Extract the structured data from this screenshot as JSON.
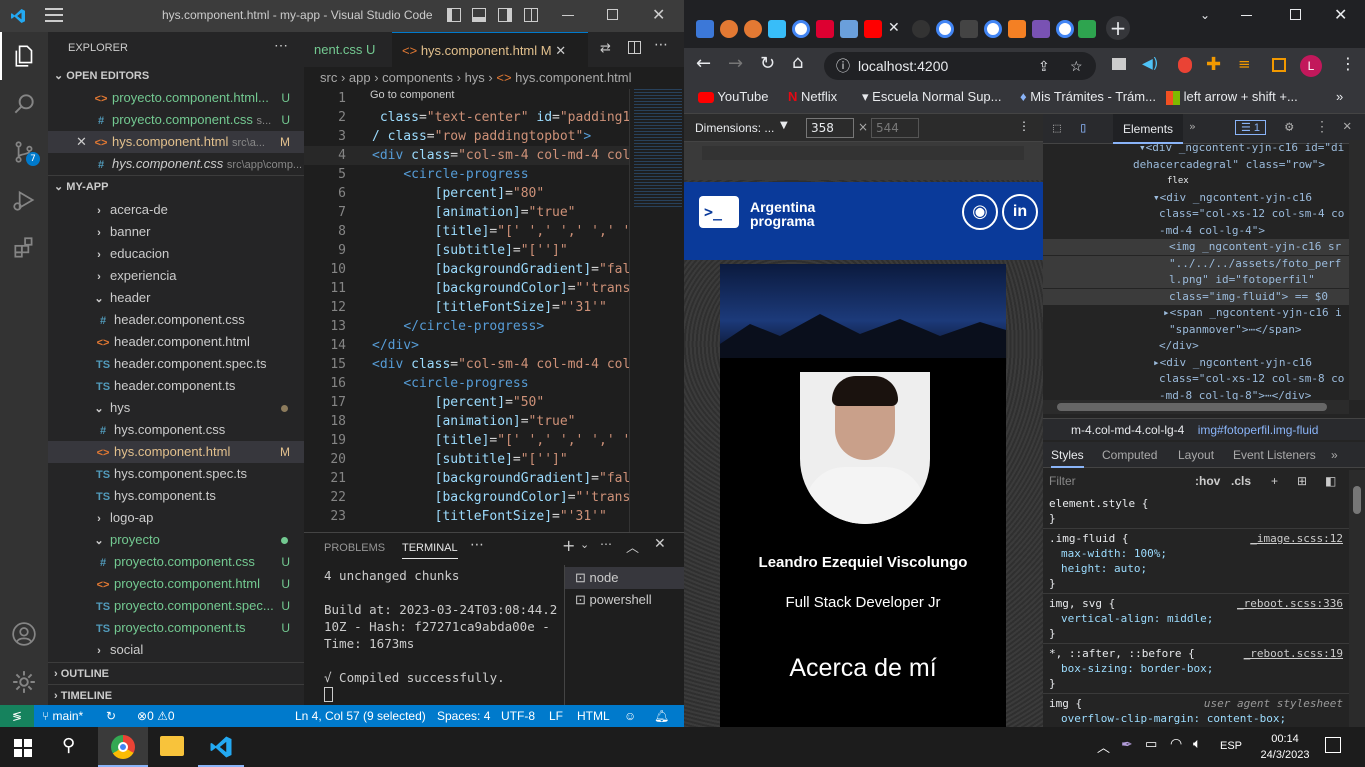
{
  "vscode": {
    "window_title": "hys.component.html - my-app - Visual Studio Code",
    "explorer_title": "EXPLORER",
    "open_editors_label": "OPEN EDITORS",
    "open_editors": [
      {
        "icon": "<>",
        "kind": "html",
        "name": "proyecto.component.html...",
        "badge": "U"
      },
      {
        "icon": "#",
        "kind": "css",
        "name": "proyecto.component.css",
        "hint": "s...",
        "badge": "U"
      },
      {
        "icon": "<>",
        "kind": "html",
        "name": "hys.component.html",
        "hint": "src\\a...",
        "badge": "M"
      },
      {
        "icon": "#",
        "kind": "css",
        "name": "hys.component.css",
        "hint": "src\\app\\comp...",
        "badge": ""
      }
    ],
    "project_label": "MY-APP",
    "tree": [
      {
        "type": "folder",
        "name": "acerca-de",
        "indent": 1
      },
      {
        "type": "folder",
        "name": "banner",
        "indent": 1
      },
      {
        "type": "folder",
        "name": "educacion",
        "indent": 1
      },
      {
        "type": "folder",
        "name": "experiencia",
        "indent": 1
      },
      {
        "type": "folder-open",
        "name": "header",
        "indent": 1
      },
      {
        "type": "css",
        "icon": "#",
        "name": "header.component.css",
        "indent": 2
      },
      {
        "type": "html",
        "icon": "<>",
        "name": "header.component.html",
        "indent": 2
      },
      {
        "type": "ts",
        "icon": "TS",
        "name": "header.component.spec.ts",
        "indent": 2
      },
      {
        "type": "ts",
        "icon": "TS",
        "name": "header.component.ts",
        "indent": 2
      },
      {
        "type": "folder-open",
        "name": "hys",
        "indent": 1,
        "dot": "#8c7b5c"
      },
      {
        "type": "css",
        "icon": "#",
        "name": "hys.component.css",
        "indent": 2
      },
      {
        "type": "html",
        "icon": "<>",
        "name": "hys.component.html",
        "indent": 2,
        "badge": "M",
        "selected": true
      },
      {
        "type": "ts",
        "icon": "TS",
        "name": "hys.component.spec.ts",
        "indent": 2
      },
      {
        "type": "ts",
        "icon": "TS",
        "name": "hys.component.ts",
        "indent": 2
      },
      {
        "type": "folder",
        "name": "logo-ap",
        "indent": 1
      },
      {
        "type": "folder-open",
        "name": "proyecto",
        "indent": 1,
        "dot": "#73c991",
        "color": "#73c991"
      },
      {
        "type": "css",
        "icon": "#",
        "name": "proyecto.component.css",
        "indent": 2,
        "badge": "U",
        "color": "#73c991"
      },
      {
        "type": "html",
        "icon": "<>",
        "name": "proyecto.component.html",
        "indent": 2,
        "badge": "U",
        "color": "#73c991"
      },
      {
        "type": "ts",
        "icon": "TS",
        "name": "proyecto.component.spec...",
        "indent": 2,
        "badge": "U",
        "color": "#73c991"
      },
      {
        "type": "ts",
        "icon": "TS",
        "name": "proyecto.component.ts",
        "indent": 2,
        "badge": "U",
        "color": "#73c991"
      },
      {
        "type": "folder",
        "name": "social",
        "indent": 1
      }
    ],
    "outline_label": "OUTLINE",
    "timeline_label": "TIMELINE",
    "tab_css": "nent.css",
    "tab_css_badge": "U",
    "tab_html": "hys.component.html",
    "tab_html_badge": "M",
    "breadcrumb": [
      "src",
      "app",
      "components",
      "hys",
      "hys.component.html"
    ],
    "goto_hint": "Go to component",
    "code_lines": [
      {
        "n": "1",
        "html": "<span class='at'>ass</span><span class='pl'>=</span><span class='st'>\"row\"</span><span class='tg'>&gt;</span>"
      },
      {
        "n": "2",
        "html": "<span class='at'> class</span><span class='pl'>=</span><span class='st'>\"text-center\"</span><span class='at'> id</span><span class='pl'>=</span><span class='st'>\"padding1\"</span>"
      },
      {
        "n": "3",
        "html": "<span class='at'>/ class</span><span class='pl'>=</span><span class='st'>\"row paddingtopbot\"</span><span class='tg'>&gt;</span>"
      },
      {
        "n": "4",
        "html": "<span class='tg'>&lt;div</span><span class='at'> class</span><span class='pl'>=</span><span class='st'>\"col-sm-4 col-md-4 col</span>"
      },
      {
        "n": "5",
        "html": "    <span class='tg'>&lt;circle-progress</span>"
      },
      {
        "n": "6",
        "html": "        <span class='at'>[percent]</span><span class='pl'>=</span><span class='st'>\"80\"</span>"
      },
      {
        "n": "7",
        "html": "        <span class='at'>[animation]</span><span class='pl'>=</span><span class='st'>\"true\"</span>"
      },
      {
        "n": "8",
        "html": "        <span class='at'>[title]</span><span class='pl'>=</span><span class='st'>\"[' ',' ',' ',' '</span>"
      },
      {
        "n": "9",
        "html": "        <span class='at'>[subtitle]</span><span class='pl'>=</span><span class='st'>\"['']\"</span>"
      },
      {
        "n": "10",
        "html": "        <span class='at'>[backgroundGradient]</span><span class='pl'>=</span><span class='st'>\"fal</span>"
      },
      {
        "n": "11",
        "html": "        <span class='at'>[backgroundColor]</span><span class='pl'>=</span><span class='st'>\"'trans</span>"
      },
      {
        "n": "12",
        "html": "        <span class='at'>[titleFontSize]</span><span class='pl'>=</span><span class='st'>\"'31'\"</span>"
      },
      {
        "n": "13",
        "html": "    <span class='tg'>&lt;/circle-progress&gt;</span>"
      },
      {
        "n": "14",
        "html": "<span class='tg'>&lt;/div&gt;</span>"
      },
      {
        "n": "15",
        "html": "<span class='tg'>&lt;div</span><span class='at'> class</span><span class='pl'>=</span><span class='st'>\"col-sm-4 col-md-4 col</span>"
      },
      {
        "n": "16",
        "html": "    <span class='tg'>&lt;circle-progress</span>"
      },
      {
        "n": "17",
        "html": "        <span class='at'>[percent]</span><span class='pl'>=</span><span class='st'>\"50\"</span>"
      },
      {
        "n": "18",
        "html": "        <span class='at'>[animation]</span><span class='pl'>=</span><span class='st'>\"true\"</span>"
      },
      {
        "n": "19",
        "html": "        <span class='at'>[title]</span><span class='pl'>=</span><span class='st'>\"[' ',' ',' ',' '</span>"
      },
      {
        "n": "20",
        "html": "        <span class='at'>[subtitle]</span><span class='pl'>=</span><span class='st'>\"['']\"</span>"
      },
      {
        "n": "21",
        "html": "        <span class='at'>[backgroundGradient]</span><span class='pl'>=</span><span class='st'>\"fal</span>"
      },
      {
        "n": "22",
        "html": "        <span class='at'>[backgroundColor]</span><span class='pl'>=</span><span class='st'>\"'trans</span>"
      },
      {
        "n": "23",
        "html": "        <span class='at'>[titleFontSize]</span><span class='pl'>=</span><span class='st'>\"'31'\"</span>"
      }
    ],
    "panel_tabs": [
      "PROBLEMS",
      "TERMINAL"
    ],
    "terminal_lines": [
      "4 unchanged chunks",
      "",
      "Build at: 2023-03-24T03:08:44.2",
      "10Z - Hash: f27271ca9abda00e -",
      "Time: 1673ms",
      "",
      "√ Compiled successfully."
    ],
    "terminal_list": [
      "node",
      "powershell"
    ],
    "status": {
      "branch": "main*",
      "errors": "0",
      "warnings": "0",
      "position": "Ln 4, Col 57 (9 selected)",
      "spaces": "Spaces: 4",
      "encoding": "UTF-8",
      "eol": "LF",
      "language": "HTML"
    }
  },
  "chrome": {
    "url": "localhost:4200",
    "bookmarks": [
      "YouTube",
      "Netflix",
      "Escuela Normal Sup...",
      "Mis Trámites - Trám...",
      "left arrow + shift +..."
    ],
    "profile_initial": "L",
    "device_label": "Dimensions: ...",
    "width_value": "358",
    "height_placeholder": "544",
    "site": {
      "brand_line1": "Argentina",
      "brand_line2": "programa",
      "name": "Leandro Ezequiel Viscolungo",
      "role": "Full Stack Developer Jr",
      "section_title": "Acerca de mí"
    },
    "devtools": {
      "tab_elements": "Elements",
      "issues_count": "1",
      "dom_lines": [
        "▾<div _ngcontent-yjn-c16 id=\"di",
        "dehacercadegral\" class=\"row\">",
        "flex",
        "▾<div _ngcontent-yjn-c16",
        "class=\"col-xs-12 col-sm-4 co",
        "-md-4 col-lg-4\">",
        "<img _ngcontent-yjn-c16 sr",
        "\"../../../assets/foto_perf",
        "l.png\" id=\"fotoperfil\"",
        "class=\"img-fluid\"> == $0",
        "▸<span _ngcontent-yjn-c16 i",
        "\"spanmover\">⋯</span>",
        "</div>",
        "▸<div _ngcontent-yjn-c16",
        "class=\"col-xs-12 col-sm-8 co",
        "-md-8 col-lg-8\">⋯</div>"
      ],
      "crumbs": [
        "m-4.col-md-4.col-lg-4",
        "img#fotoperfil.img-fluid"
      ],
      "style_tabs": [
        "Styles",
        "Computed",
        "Layout",
        "Event Listeners"
      ],
      "filter_placeholder": "Filter",
      "hov": ":hov",
      "cls": ".cls",
      "rules": [
        {
          "selector": "element.style {",
          "source": "",
          "props": [],
          "close": "}"
        },
        {
          "selector": ".img-fluid {",
          "source": "_image.scss:12",
          "props": [
            "max-width: 100%;",
            "height: auto;"
          ],
          "close": "}"
        },
        {
          "selector": "img, svg {",
          "source": "_reboot.scss:336",
          "props": [
            "vertical-align: middle;"
          ],
          "close": "}"
        },
        {
          "selector": "*, ::after, ::before {",
          "source": "_reboot.scss:19",
          "props": [
            "box-sizing: border-box;"
          ],
          "close": "}"
        },
        {
          "selector": "img {",
          "source": "user agent stylesheet",
          "props": [
            "overflow-clip-margin: content-box;"
          ],
          "close": ""
        }
      ]
    }
  },
  "taskbar": {
    "language": "ESP",
    "time": "00:14",
    "date": "24/3/2023"
  }
}
